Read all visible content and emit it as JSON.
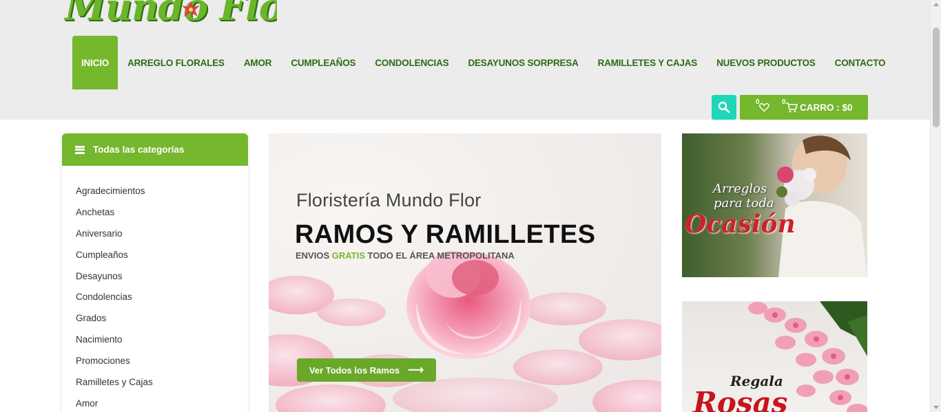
{
  "brand": {
    "logo_text": "Mundo Flor"
  },
  "nav": {
    "items": [
      {
        "label": "INICIO"
      },
      {
        "label": "ARREGLO FLORALES"
      },
      {
        "label": "AMOR"
      },
      {
        "label": "CUMPLEAÑOS"
      },
      {
        "label": "CONDOLENCIAS"
      },
      {
        "label": "DESAYUNOS SORPRESA"
      },
      {
        "label": "RAMILLETES Y CAJAS"
      },
      {
        "label": "NUEVOS PRODUCTOS"
      },
      {
        "label": "CONTACTO"
      }
    ],
    "active_index": 0
  },
  "header_actions": {
    "search_icon": "search-icon",
    "wishlist_count": "0",
    "cart_count": "0",
    "cart_label": "CARRO : $0"
  },
  "sidebar": {
    "heading": "Todas las categorías",
    "categories": [
      "Agradecimientos",
      "Anchetas",
      "Aniversario",
      "Cumpleaños",
      "Desayunos",
      "Condolencias",
      "Grados",
      "Nacimiento",
      "Promociones",
      "Ramilletes y Cajas",
      "Amor"
    ]
  },
  "hero": {
    "subtitle": "Floristería Mundo Flor",
    "title": "RAMOS Y RAMILLETES",
    "tagline_pre": "ENVIOS ",
    "tagline_highlight": "GRATIS",
    "tagline_post": " TODO EL ÁREA METROPOLITANA",
    "button_label": "Ver Todos los Ramos",
    "button_arrow": "⟶"
  },
  "promos": {
    "first": {
      "line1": "Arreglos",
      "line2": "para toda",
      "big": "Ocasión"
    },
    "second": {
      "line1": "Regala",
      "big": "Rosas"
    }
  },
  "colors": {
    "accent_green": "#75b72d",
    "nav_text": "#2e6a12",
    "search_teal": "#1ed7b8",
    "header_bg": "#ececec"
  }
}
